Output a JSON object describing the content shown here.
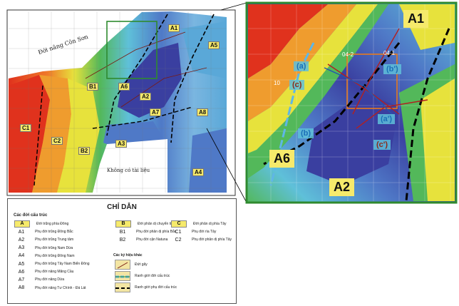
{
  "map": {
    "labels": {
      "doi_nang": "Đới nâng Côn Sơn",
      "khong_co": "Không có tài liệu"
    },
    "zones": [
      {
        "code": "A1",
        "panel": "main"
      },
      {
        "code": "A5",
        "panel": "main"
      },
      {
        "code": "B1",
        "panel": "main"
      },
      {
        "code": "A6",
        "panel": "main"
      },
      {
        "code": "A2",
        "panel": "main"
      },
      {
        "code": "A7",
        "panel": "main"
      },
      {
        "code": "A8",
        "panel": "main"
      },
      {
        "code": "C1",
        "panel": "main"
      },
      {
        "code": "C2",
        "panel": "main"
      },
      {
        "code": "B2",
        "panel": "main"
      },
      {
        "code": "A3",
        "panel": "main"
      },
      {
        "code": "A4",
        "panel": "main"
      }
    ],
    "inset": {
      "zones": [
        "A1",
        "A6",
        "A2"
      ],
      "markers": [
        "(a)",
        "(b')",
        "(c)",
        "(b)",
        "(a')",
        "(c')"
      ],
      "blocks": [
        "04-2",
        "04-1",
        "10"
      ]
    }
  },
  "legend": {
    "title": "CHỈ DẪN",
    "structures_title": "Các đới cấu trúc",
    "col1": [
      {
        "code": "A",
        "text": "Đới trũng phía Đông",
        "boxed": true
      },
      {
        "code": "A1",
        "text": "Phụ đới trũng Đông Bắc"
      },
      {
        "code": "A2",
        "text": "Phụ đới trũng Trung tâm"
      },
      {
        "code": "A3",
        "text": "Phụ đới trũng Nam Dừa"
      },
      {
        "code": "A4",
        "text": "Phụ đới trũng Đông Nam"
      },
      {
        "code": "A5",
        "text": "Phụ đới trũng Tây Nam Biển Đông"
      },
      {
        "code": "A6",
        "text": "Phụ đới nâng Mãng Cầu"
      },
      {
        "code": "A7",
        "text": "Phụ đới nâng Dừa"
      },
      {
        "code": "A8",
        "text": "Phụ đới nâng Tư Chính - Đá Lát"
      }
    ],
    "col2": [
      {
        "code": "B",
        "text": "Đới phân dị chuyển tiếp",
        "boxed": true
      },
      {
        "code": "B1",
        "text": "Phụ đới phân dị phía Bắc"
      },
      {
        "code": "B2",
        "text": "Phụ đới cận Natuna"
      }
    ],
    "col3": [
      {
        "code": "C",
        "text": "Đới phân dị phía Tây",
        "boxed": true
      },
      {
        "code": "C1",
        "text": "Phụ đới rìa Tây"
      },
      {
        "code": "C2",
        "text": "Phụ đới phân dị phía Tây"
      }
    ],
    "symbols_title": "Các ký hiệu khác",
    "symbols": [
      {
        "text": "Đứt gãy",
        "kind": "fault"
      },
      {
        "text": "Ranh giới đới cấu trúc",
        "kind": "zone"
      },
      {
        "text": "Ranh giới phụ đới cấu trúc",
        "kind": "subzone"
      }
    ]
  },
  "colors": {
    "blue_deep": "#3a3fa0",
    "blue": "#4f79c7",
    "cyan": "#5fc0d9",
    "green": "#53b85a",
    "yellow": "#e7e23c",
    "orange": "#ef9c2e",
    "red": "#e0321d",
    "label_bg": "#f6ea6b",
    "inset_border": "#2f8a2f",
    "marker_blue": "#1b6fb8",
    "marker_brown": "#8a2a1a"
  }
}
